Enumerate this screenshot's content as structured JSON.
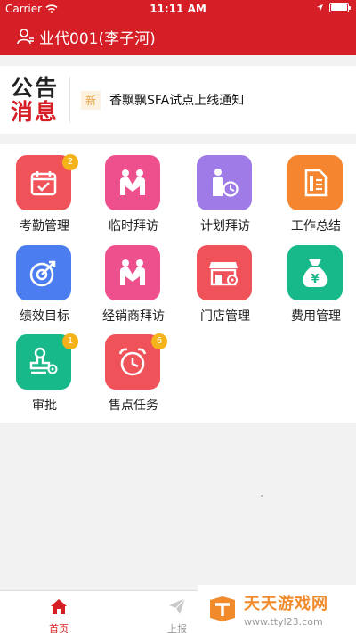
{
  "status_bar": {
    "carrier": "Carrier",
    "time": "11:11 AM"
  },
  "header": {
    "user_name": "业代001(李子河)"
  },
  "notice": {
    "logo_line1": "公告",
    "logo_line2": "消息",
    "badge": "新",
    "text": "香飘飘SFA试点上线通知"
  },
  "menu": [
    {
      "label": "考勤管理",
      "badge": "2",
      "color": "#f0525a",
      "icon": "calendar-check-icon"
    },
    {
      "label": "临时拜访",
      "badge": "",
      "color": "#ee4f8d",
      "icon": "handshake-icon"
    },
    {
      "label": "计划拜访",
      "badge": "",
      "color": "#9f7be7",
      "icon": "person-clock-icon"
    },
    {
      "label": "工作总结",
      "badge": "",
      "color": "#f6852f",
      "icon": "document-icon"
    },
    {
      "label": "绩效目标",
      "badge": "",
      "color": "#4c7df0",
      "icon": "target-icon"
    },
    {
      "label": "经销商拜访",
      "badge": "",
      "color": "#ee4f8d",
      "icon": "handshake-icon"
    },
    {
      "label": "门店管理",
      "badge": "",
      "color": "#f0525a",
      "icon": "store-icon"
    },
    {
      "label": "费用管理",
      "badge": "",
      "color": "#17b889",
      "icon": "money-bag-icon"
    },
    {
      "label": "审批",
      "badge": "1",
      "color": "#17b889",
      "icon": "stamp-icon"
    },
    {
      "label": "售点任务",
      "badge": "6",
      "color": "#f0525a",
      "icon": "alarm-clock-icon"
    }
  ],
  "tabbar": {
    "home": "首页",
    "report": "上报"
  },
  "watermark": {
    "title": "天天游戏网",
    "url": "www.ttyl23.com"
  }
}
